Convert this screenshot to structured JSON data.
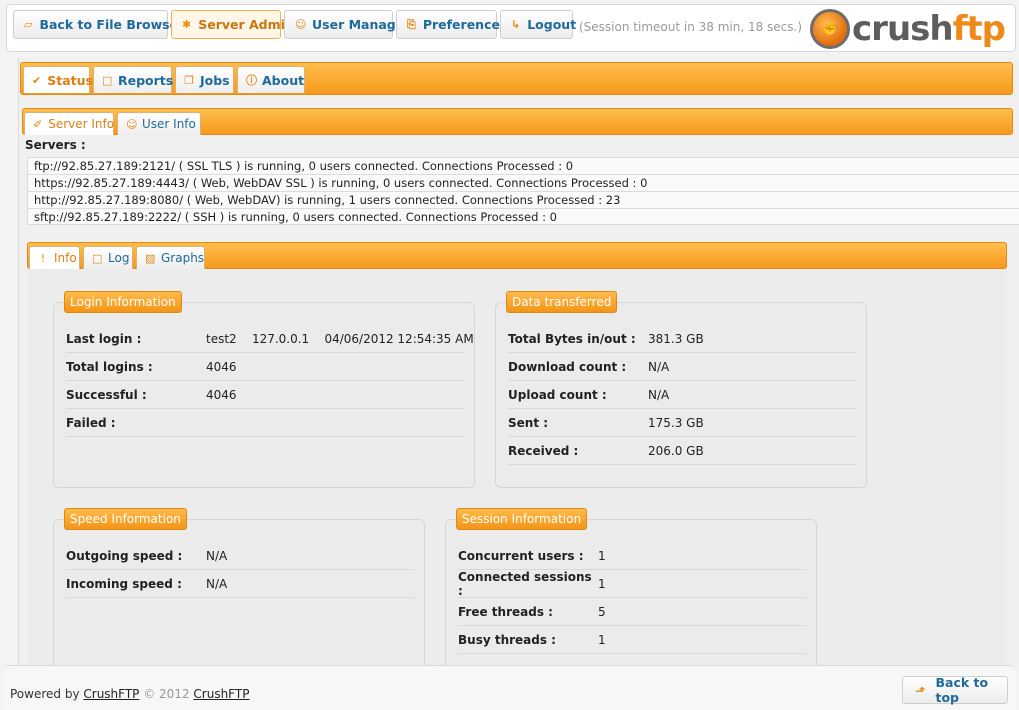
{
  "nav": {
    "buttons": [
      {
        "label": "Back to File Browser",
        "icon": "folder-open-icon",
        "glyph": "▱"
      },
      {
        "label": "Server Admin",
        "icon": "gear-icon",
        "glyph": "✱"
      },
      {
        "label": "User Manager",
        "icon": "user-icon",
        "glyph": "☺"
      },
      {
        "label": "Preferences",
        "icon": "preferences-icon",
        "glyph": "⎘"
      },
      {
        "label": "Logout",
        "icon": "logout-icon",
        "glyph": "↳"
      }
    ],
    "active": "Server Admin",
    "session_timeout": "(Session timeout in 38 min, 18 secs.)"
  },
  "logo": {
    "crush": "crush",
    "ftp": "ftp",
    "badge": "✊"
  },
  "main_tabs": [
    {
      "label": "Status",
      "glyph": "✔",
      "icon": "check-icon"
    },
    {
      "label": "Reports",
      "glyph": "□",
      "icon": "reports-icon"
    },
    {
      "label": "Jobs",
      "glyph": "❐",
      "icon": "jobs-icon"
    },
    {
      "label": "About",
      "glyph": "ⓘ",
      "icon": "info-icon"
    }
  ],
  "sub_tabs": [
    {
      "label": "Server Info",
      "glyph": "✐",
      "icon": "wrench-icon"
    },
    {
      "label": "User Info",
      "glyph": "☺",
      "icon": "user-icon"
    }
  ],
  "servers": {
    "label": "Servers :",
    "rows": [
      "ftp://92.85.27.189:2121/ ( SSL TLS ) is running, 0 users connected. Connections Processed : 0",
      "https://92.85.27.189:4443/ ( Web, WebDAV SSL ) is running, 0 users connected. Connections Processed : 0",
      "http://92.85.27.189:8080/ ( Web, WebDAV) is running, 1 users connected. Connections Processed : 23",
      "sftp://92.85.27.189:2222/ ( SSH ) is running, 0 users connected. Connections Processed : 0"
    ]
  },
  "info_tabs": [
    {
      "label": "Info",
      "glyph": "!",
      "icon": "exclamation-icon"
    },
    {
      "label": "Log",
      "glyph": "□",
      "icon": "log-icon"
    },
    {
      "label": "Graphs",
      "glyph": "▨",
      "icon": "graph-icon"
    }
  ],
  "login_info": {
    "title": "Login Information",
    "rows": [
      {
        "label": "Last login :",
        "value": "test2    127.0.0.1    04/06/2012 12:54:35 AM"
      },
      {
        "label": "Total logins :",
        "value": "4046"
      },
      {
        "label": "Successful :",
        "value": "4046"
      },
      {
        "label": "Failed :",
        "value": ""
      }
    ]
  },
  "data_transferred": {
    "title": "Data transferred",
    "rows": [
      {
        "label": "Total Bytes in/out :",
        "value": "381.3 GB"
      },
      {
        "label": "Download count :",
        "value": "N/A"
      },
      {
        "label": "Upload count :",
        "value": "N/A"
      },
      {
        "label": "Sent :",
        "value": "175.3 GB"
      },
      {
        "label": "Received :",
        "value": "206.0 GB"
      }
    ]
  },
  "speed_info": {
    "title": "Speed Information",
    "rows": [
      {
        "label": "Outgoing speed :",
        "value": "N/A"
      },
      {
        "label": "Incoming speed :",
        "value": "N/A"
      }
    ]
  },
  "session_info": {
    "title": "Session Information",
    "rows": [
      {
        "label": "Concurrent users :",
        "value": "1"
      },
      {
        "label": "Connected sessions :",
        "value": "1"
      },
      {
        "label": "Free threads :",
        "value": "5"
      },
      {
        "label": "Busy threads :",
        "value": "1"
      }
    ]
  },
  "footer": {
    "powered_by": "Powered by ",
    "link1": "CrushFTP",
    "copyright": " © 2012 ",
    "link2": "CrushFTP",
    "back_to_top": "Back to top",
    "back_glyph": "⬏"
  }
}
